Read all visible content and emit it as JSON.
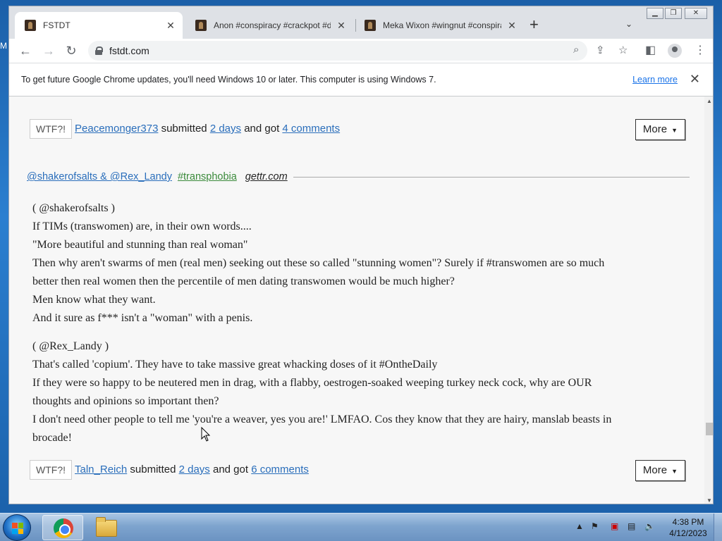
{
  "browser": {
    "tabs": [
      {
        "title": "FSTDT",
        "active": true
      },
      {
        "title": "Anon #conspiracy #crackpot #du"
      },
      {
        "title": "Meka Wixon #wingnut #conspira"
      }
    ],
    "new_tab_label": "+",
    "url": "fstdt.com",
    "window_controls": [
      "minimize",
      "restore",
      "close"
    ]
  },
  "infobar": {
    "message": "To get future Google Chrome updates, you'll need Windows 10 or later. This computer is using Windows 7.",
    "learn_more": "Learn more"
  },
  "posts": [
    {
      "footer": {
        "wtf_label": "WTF?!",
        "submitter": "Peacemonger373",
        "submitted_text": "submitted",
        "time": "2 days",
        "got_text": "and got",
        "comments": "4 comments",
        "more_label": "More"
      }
    },
    {
      "header": {
        "authors": "@shakerofsalts & @Rex_Landy",
        "tag": "#transphobia",
        "source": "gettr.com"
      },
      "quotes": [
        {
          "lines": [
            "( @shakerofsalts )",
            "If TIMs (transwomen) are, in their own words....",
            "\"More beautiful and stunning than real woman\"",
            "Then why aren't swarms of men (real men) seeking out these so called \"stunning women\"? Surely if #transwomen are so much",
            "better then real women then the percentile of men dating transwomen would be much higher?",
            "Men know what they want.",
            "And it sure as f*** isn't a \"woman\" with a penis."
          ]
        },
        {
          "lines": [
            "( @Rex_Landy )",
            "That's called 'copium'. They have to take massive great whacking doses of it #OntheDaily",
            "If they were so happy to be neutered men in drag, with a flabby, oestrogen-soaked weeping turkey neck cock, why are OUR",
            "thoughts and opinions so important then?",
            "I don't need other people to tell me 'you're a weaver, yes you are!' LMFAO. Cos they know that they are hairy, manslab beasts in",
            "brocade!"
          ]
        }
      ],
      "footer": {
        "wtf_label": "WTF?!",
        "submitter": "Taln_Reich",
        "submitted_text": "submitted",
        "time": "2 days",
        "got_text": "and got",
        "comments": "6 comments",
        "more_label": "More"
      }
    }
  ],
  "taskbar": {
    "apps": [
      "start-button",
      "chrome",
      "windows-explorer"
    ],
    "clock_time": "4:38 PM",
    "clock_date": "4/12/2023"
  },
  "colors": {
    "link": "#2a6ebb",
    "tag": "#3a8a3a",
    "page_bg": "#f7f7f7"
  }
}
